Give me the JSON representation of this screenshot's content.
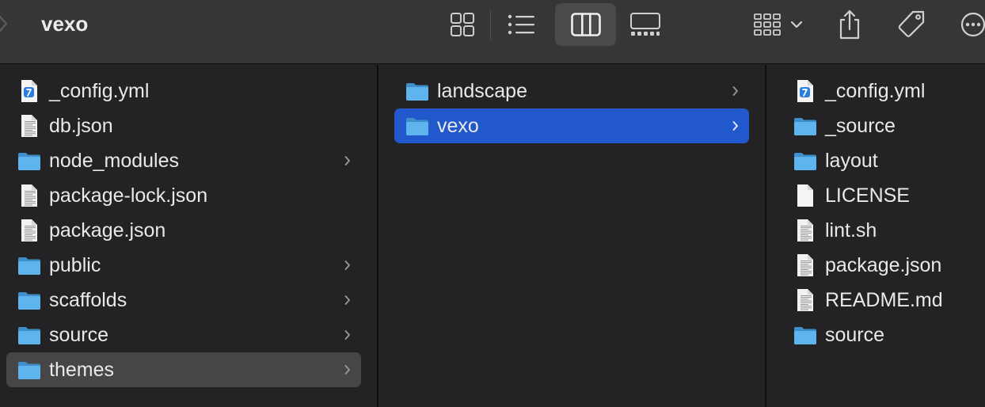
{
  "window": {
    "title": "vexo"
  },
  "toolbar": {
    "icons": [
      "back-chevron-icon",
      "icon-view-icon",
      "list-view-icon",
      "column-view-icon",
      "gallery-view-icon",
      "group-icon",
      "dropdown-chevron-icon",
      "share-icon",
      "tag-icon",
      "more-icon"
    ],
    "selected_view": "column-view"
  },
  "colors": {
    "toolbar_bg": "#363638",
    "pane_bg": "#232325",
    "selection_active": "#2158cc",
    "selection_inactive": "#464649",
    "folder": "#5eb4ec"
  },
  "columns": [
    {
      "items": [
        {
          "name": "_config.yml",
          "kind": "yaml-file",
          "has_children": false,
          "selected": ""
        },
        {
          "name": "db.json",
          "kind": "text-file",
          "has_children": false,
          "selected": ""
        },
        {
          "name": "node_modules",
          "kind": "folder",
          "has_children": true,
          "selected": ""
        },
        {
          "name": "package-lock.json",
          "kind": "text-file",
          "has_children": false,
          "selected": ""
        },
        {
          "name": "package.json",
          "kind": "text-file",
          "has_children": false,
          "selected": ""
        },
        {
          "name": "public",
          "kind": "folder",
          "has_children": true,
          "selected": ""
        },
        {
          "name": "scaffolds",
          "kind": "folder",
          "has_children": true,
          "selected": ""
        },
        {
          "name": "source",
          "kind": "folder",
          "has_children": true,
          "selected": ""
        },
        {
          "name": "themes",
          "kind": "folder",
          "has_children": true,
          "selected": "inactive"
        }
      ]
    },
    {
      "items": [
        {
          "name": "landscape",
          "kind": "folder",
          "has_children": true,
          "selected": ""
        },
        {
          "name": "vexo",
          "kind": "folder",
          "has_children": true,
          "selected": "active"
        }
      ]
    },
    {
      "items": [
        {
          "name": "_config.yml",
          "kind": "yaml-file",
          "has_children": false,
          "selected": ""
        },
        {
          "name": "_source",
          "kind": "folder",
          "has_children": false,
          "selected": ""
        },
        {
          "name": "layout",
          "kind": "folder",
          "has_children": false,
          "selected": ""
        },
        {
          "name": "LICENSE",
          "kind": "blank-file",
          "has_children": false,
          "selected": ""
        },
        {
          "name": "lint.sh",
          "kind": "text-file",
          "has_children": false,
          "selected": ""
        },
        {
          "name": "package.json",
          "kind": "text-file",
          "has_children": false,
          "selected": ""
        },
        {
          "name": "README.md",
          "kind": "text-file",
          "has_children": false,
          "selected": ""
        },
        {
          "name": "source",
          "kind": "folder",
          "has_children": false,
          "selected": ""
        }
      ]
    }
  ]
}
